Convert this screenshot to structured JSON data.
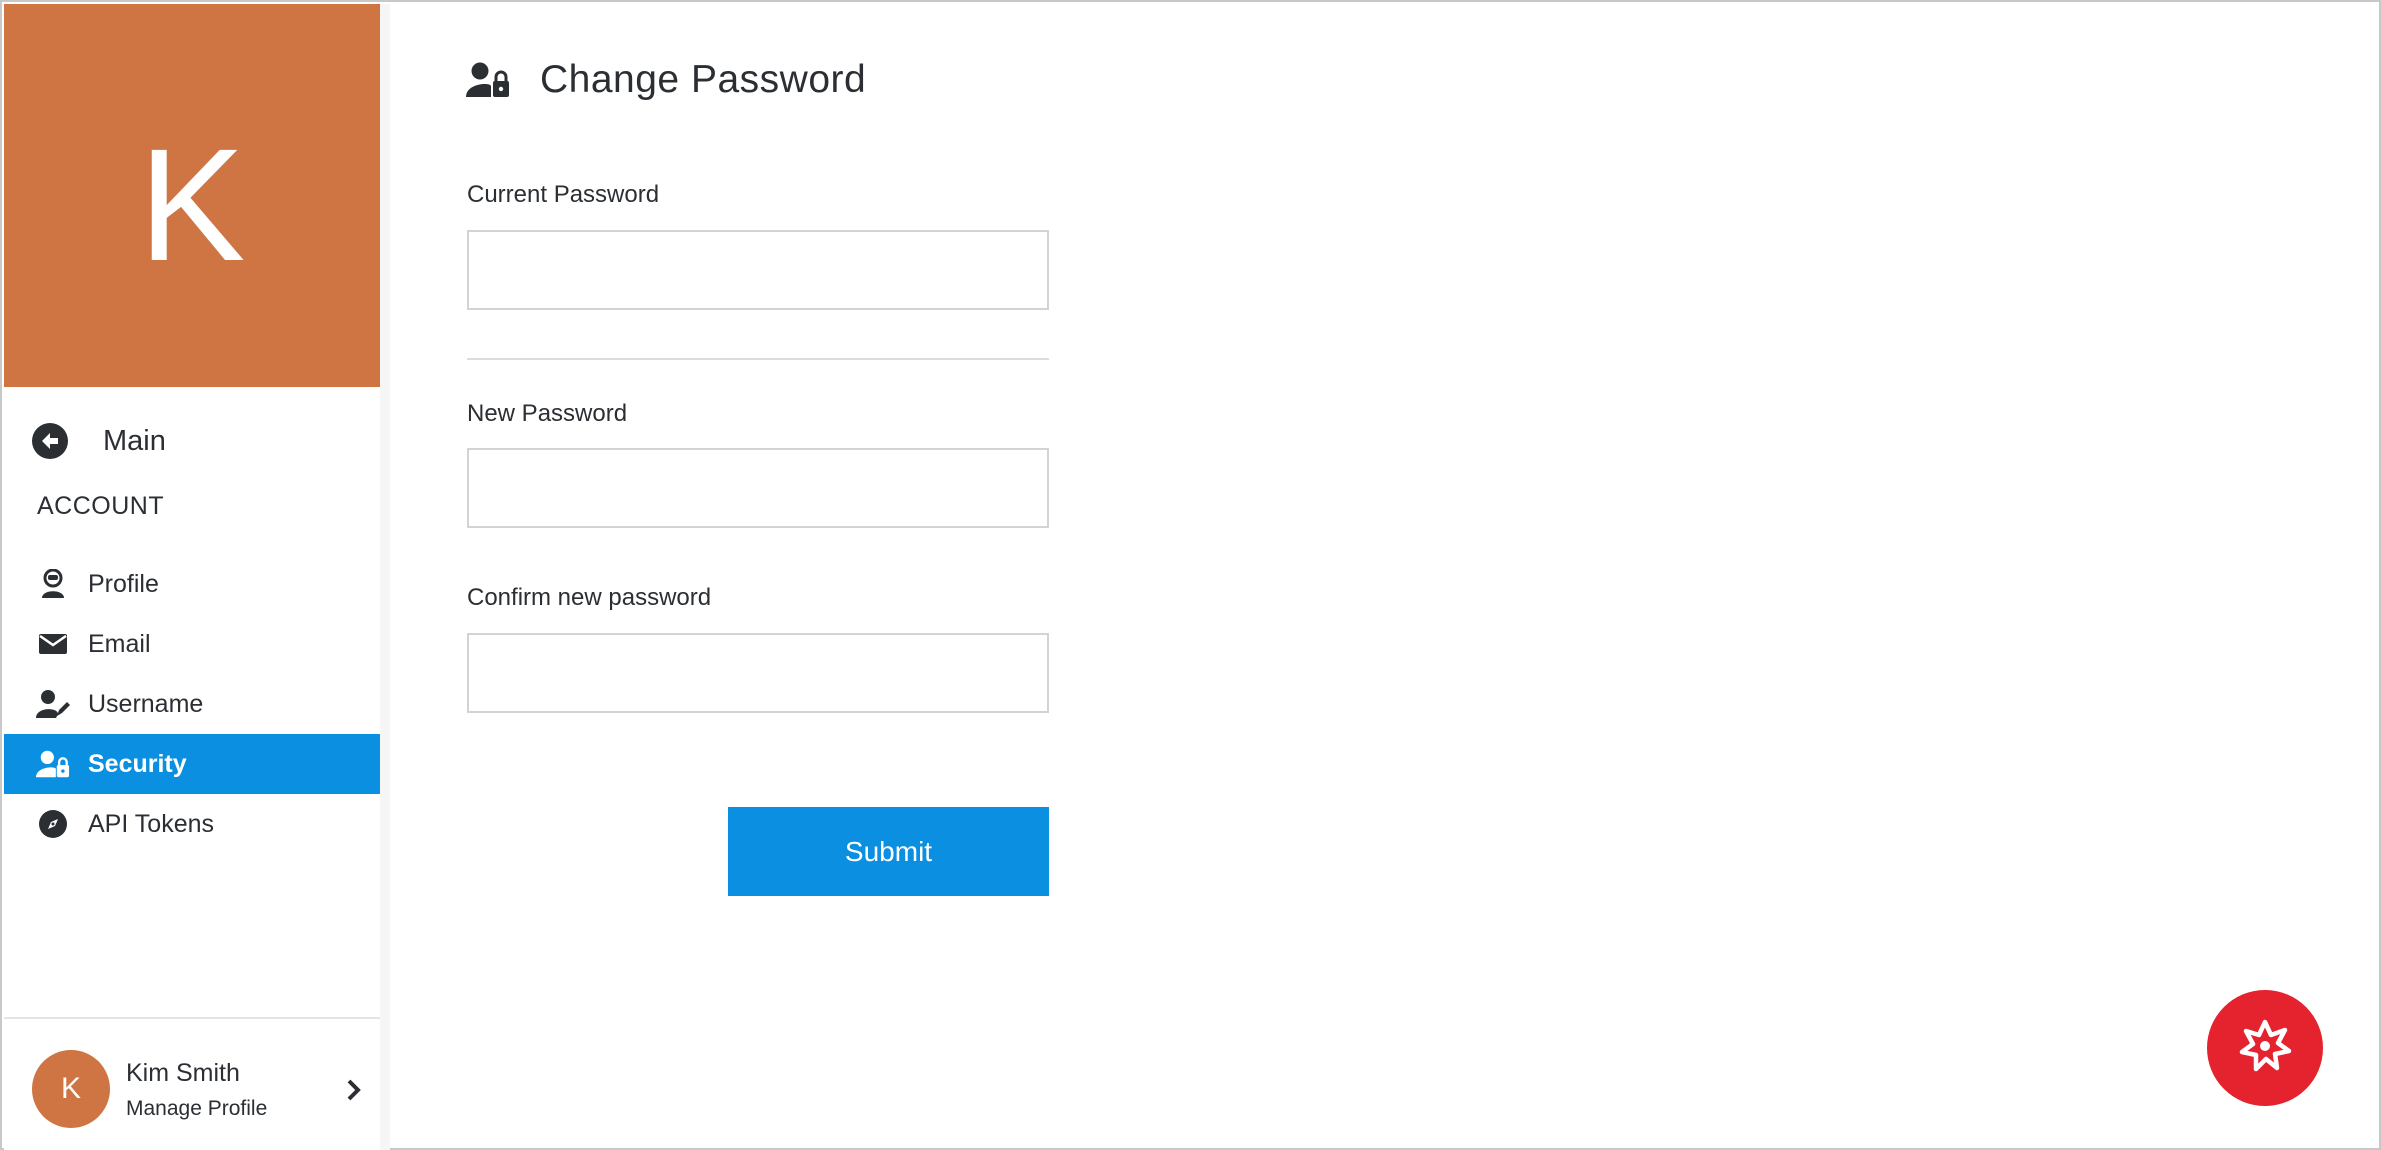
{
  "colors": {
    "avatar_accent": "#CE7543",
    "primary": "#0A8FE1",
    "text": "#2B2F33",
    "fab": "#E4232F"
  },
  "sidebar": {
    "avatar_letter": "K",
    "main_link": {
      "label": "Main",
      "icon": "arrow-left-circle-icon"
    },
    "section_heading": "ACCOUNT",
    "items": [
      {
        "label": "Profile",
        "icon": "user-badge-icon",
        "active": false
      },
      {
        "label": "Email",
        "icon": "envelope-icon",
        "active": false
      },
      {
        "label": "Username",
        "icon": "user-edit-icon",
        "active": false
      },
      {
        "label": "Security",
        "icon": "user-lock-icon",
        "active": true
      },
      {
        "label": "API Tokens",
        "icon": "compass-icon",
        "active": false
      }
    ],
    "footer": {
      "avatar_letter": "K",
      "name": "Kim Smith",
      "subtitle": "Manage Profile",
      "icon": "chevron-right-icon"
    }
  },
  "main": {
    "title": "Change Password",
    "title_icon": "user-lock-icon",
    "fields": {
      "current": {
        "label": "Current Password",
        "value": ""
      },
      "new": {
        "label": "New Password",
        "value": ""
      },
      "confirm": {
        "label": "Confirm new password",
        "value": ""
      }
    },
    "submit_label": "Submit"
  },
  "help_button": {
    "icon": "starburst-help-icon"
  }
}
